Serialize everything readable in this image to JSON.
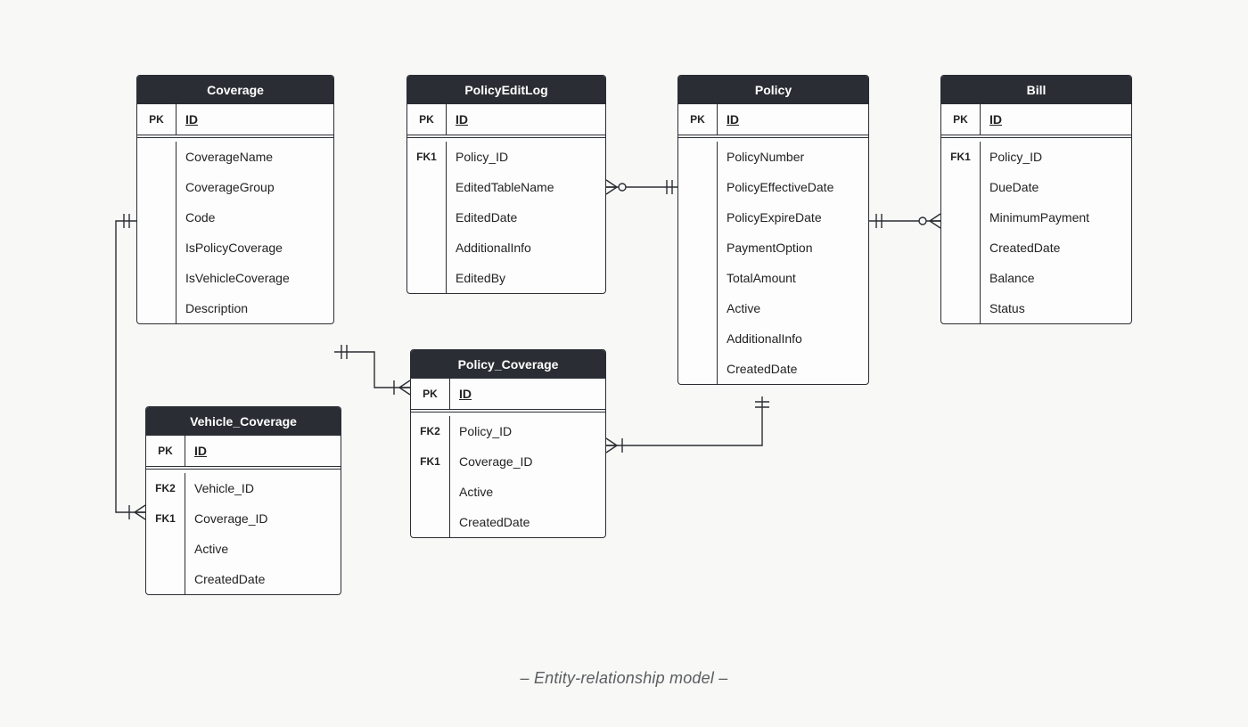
{
  "caption": "–  Entity-relationship model  –",
  "entities": {
    "coverage": {
      "title": "Coverage",
      "rows": [
        {
          "key": "PK",
          "name": "ID",
          "pk": true
        },
        {
          "sep": true
        },
        {
          "key": "",
          "name": "CoverageName"
        },
        {
          "key": "",
          "name": "CoverageGroup"
        },
        {
          "key": "",
          "name": "Code"
        },
        {
          "key": "",
          "name": "IsPolicyCoverage"
        },
        {
          "key": "",
          "name": "IsVehicleCoverage"
        },
        {
          "key": "",
          "name": "Description"
        }
      ]
    },
    "policyEditLog": {
      "title": "PolicyEditLog",
      "rows": [
        {
          "key": "PK",
          "name": "ID",
          "pk": true
        },
        {
          "sep": true
        },
        {
          "key": "FK1",
          "name": "Policy_ID"
        },
        {
          "key": "",
          "name": "EditedTableName"
        },
        {
          "key": "",
          "name": "EditedDate"
        },
        {
          "key": "",
          "name": "AdditionalInfo"
        },
        {
          "key": "",
          "name": "EditedBy"
        }
      ]
    },
    "policy": {
      "title": "Policy",
      "rows": [
        {
          "key": "PK",
          "name": "ID",
          "pk": true
        },
        {
          "sep": true
        },
        {
          "key": "",
          "name": "PolicyNumber"
        },
        {
          "key": "",
          "name": "PolicyEffectiveDate"
        },
        {
          "key": "",
          "name": "PolicyExpireDate"
        },
        {
          "key": "",
          "name": "PaymentOption"
        },
        {
          "key": "",
          "name": "TotalAmount"
        },
        {
          "key": "",
          "name": "Active"
        },
        {
          "key": "",
          "name": "AdditionalInfo"
        },
        {
          "key": "",
          "name": "CreatedDate"
        }
      ]
    },
    "bill": {
      "title": "Bill",
      "rows": [
        {
          "key": "PK",
          "name": "ID",
          "pk": true
        },
        {
          "sep": true
        },
        {
          "key": "FK1",
          "name": "Policy_ID"
        },
        {
          "key": "",
          "name": "DueDate"
        },
        {
          "key": "",
          "name": "MinimumPayment"
        },
        {
          "key": "",
          "name": "CreatedDate"
        },
        {
          "key": "",
          "name": "Balance"
        },
        {
          "key": "",
          "name": "Status"
        }
      ]
    },
    "policyCoverage": {
      "title": "Policy_Coverage",
      "rows": [
        {
          "key": "PK",
          "name": "ID",
          "pk": true
        },
        {
          "sep": true
        },
        {
          "key": "FK2",
          "name": "Policy_ID"
        },
        {
          "key": "FK1",
          "name": "Coverage_ID"
        },
        {
          "key": "",
          "name": "Active"
        },
        {
          "key": "",
          "name": "CreatedDate"
        }
      ]
    },
    "vehicleCoverage": {
      "title": "Vehicle_Coverage",
      "rows": [
        {
          "key": "PK",
          "name": "ID",
          "pk": true
        },
        {
          "sep": true
        },
        {
          "key": "FK2",
          "name": "Vehicle_ID"
        },
        {
          "key": "FK1",
          "name": "Coverage_ID"
        },
        {
          "key": "",
          "name": "Active"
        },
        {
          "key": "",
          "name": "CreatedDate"
        }
      ]
    }
  },
  "relationships": [
    {
      "from": "PolicyEditLog",
      "to": "Policy",
      "fromCard": "many-optional",
      "toCard": "one"
    },
    {
      "from": "Bill",
      "to": "Policy",
      "fromCard": "many-optional",
      "toCard": "one"
    },
    {
      "from": "Policy_Coverage",
      "to": "Policy",
      "fromCard": "many",
      "toCard": "one"
    },
    {
      "from": "Policy_Coverage",
      "to": "Coverage",
      "fromCard": "many",
      "toCard": "one"
    },
    {
      "from": "Vehicle_Coverage",
      "to": "Coverage",
      "fromCard": "many",
      "toCard": "one"
    }
  ]
}
